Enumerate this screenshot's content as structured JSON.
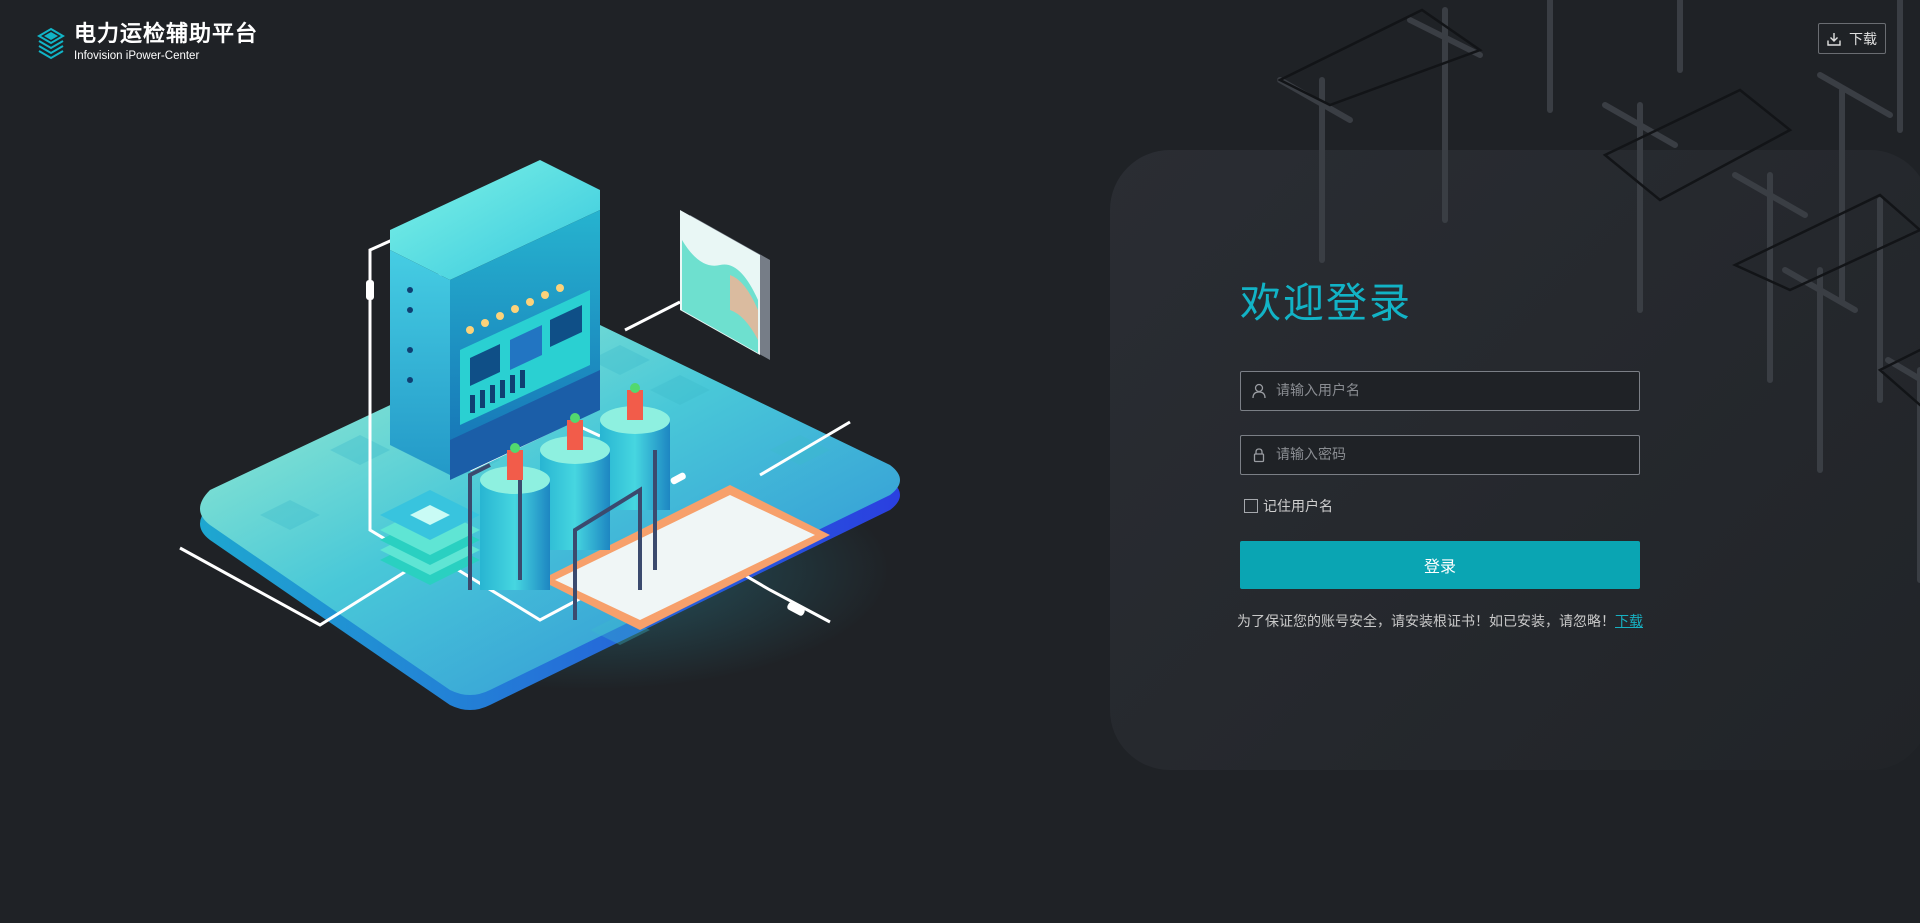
{
  "header": {
    "title": "电力运检辅助平台",
    "subtitle": "Infovision iPower-Center",
    "download_label": "下载"
  },
  "login": {
    "welcome": "欢迎登录",
    "username_placeholder": "请输入用户名",
    "password_placeholder": "请输入密码",
    "remember_label": "记住用户名",
    "login_label": "登录",
    "notice_text": "为了保证您的账号安全，请安装根证书！如已安装，请忽略！",
    "notice_link": "下载"
  },
  "colors": {
    "accent": "#12b3c6",
    "button": "#0aa5b3",
    "background": "#1f2226"
  },
  "icons": {
    "logo": "layers-logo-icon",
    "download": "download-icon",
    "user": "user-icon",
    "lock": "lock-icon"
  }
}
